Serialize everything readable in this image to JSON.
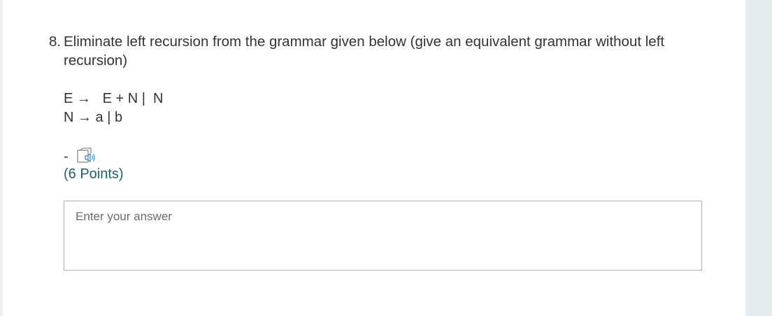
{
  "question": {
    "number": "8.",
    "text": "Eliminate left recursion from the grammar given below (give an equivalent grammar without left recursion)"
  },
  "grammar": {
    "lines": [
      "E →   E + N |  N",
      "N → a | b"
    ]
  },
  "media": {
    "dash": "-",
    "icon": "immersive-reader-speaker-icon"
  },
  "points_label": "(6 Points)",
  "answer": {
    "placeholder": "Enter your answer",
    "value": ""
  },
  "colors": {
    "text": "#333333",
    "points": "#1f5f6e",
    "border": "#b3b3b3",
    "background": "#e9eef2",
    "icon_accent": "#2a8fd1"
  }
}
